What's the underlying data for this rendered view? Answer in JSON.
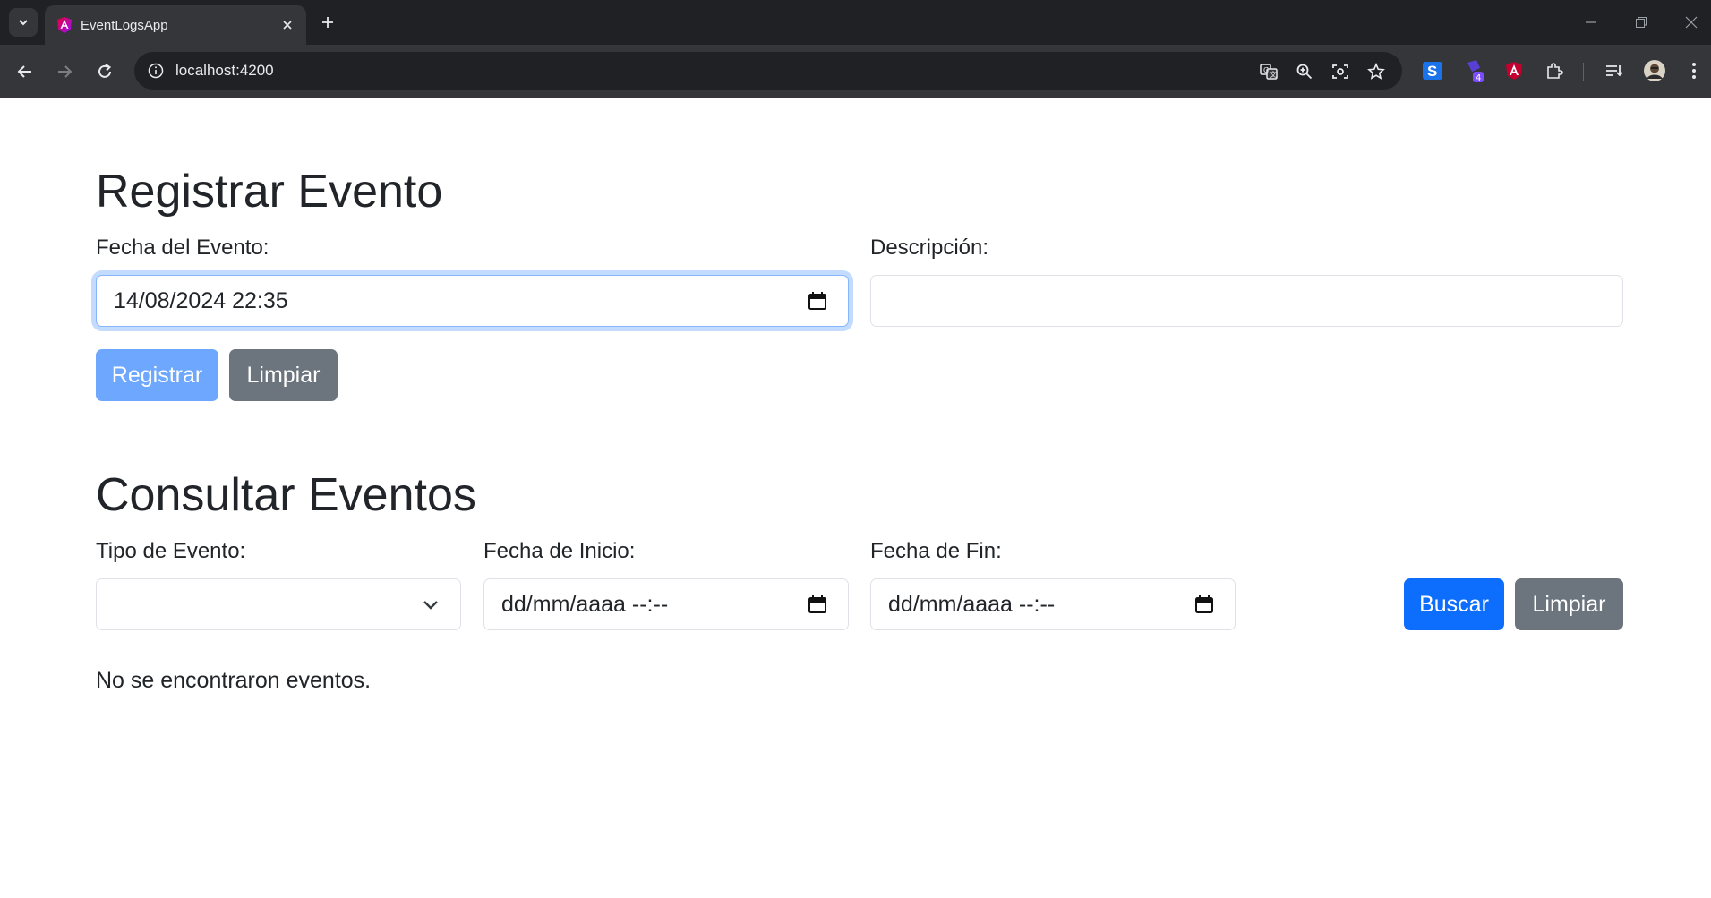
{
  "browser": {
    "tab_title": "EventLogsApp",
    "url": "localhost:4200",
    "extension_badge": "4"
  },
  "register": {
    "title": "Registrar Evento",
    "date_label": "Fecha del Evento:",
    "date_value": "14/08/2024 22:35",
    "description_label": "Descripción:",
    "description_value": "",
    "submit_label": "Registrar",
    "clear_label": "Limpiar"
  },
  "query": {
    "title": "Consultar Eventos",
    "type_label": "Tipo de Evento:",
    "type_selected": "",
    "start_label": "Fecha de Inicio:",
    "start_placeholder": "dd/mm/aaaa --:--",
    "end_label": "Fecha de Fin:",
    "end_placeholder": "dd/mm/aaaa --:--",
    "search_label": "Buscar",
    "clear_label": "Limpiar",
    "empty_message": "No se encontraron eventos."
  },
  "colors": {
    "primary": "#0d6efd",
    "primary_disabled": "#6ea8fe",
    "secondary": "#6c757d",
    "focus_ring": "#86b7fe"
  }
}
